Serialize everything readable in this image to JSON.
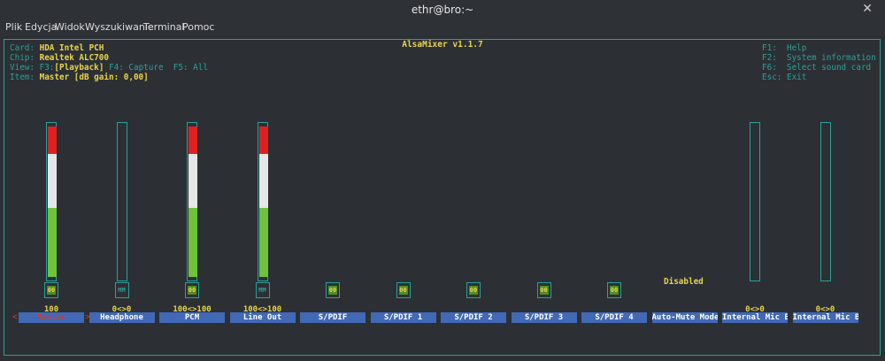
{
  "window": {
    "title": "ethr@bro:~"
  },
  "menu": [
    "Plik",
    "Edycja",
    "Widok",
    "Wyszukiwanie",
    "Terminal",
    "Pomoc"
  ],
  "mixer": {
    "title": "AlsaMixer v1.1.7",
    "card_label": "Card:",
    "card_value": "HDA Intel PCH",
    "chip_label": "Chip:",
    "chip_value": "Realtek ALC700",
    "view_label": "View:",
    "view_f3": "F3:",
    "view_playback": "[Playback]",
    "view_rest": "F4: Capture  F5: All",
    "item_label": "Item:",
    "item_value": "Master [dB gain: 0,00]",
    "help": [
      "F1:  Help",
      "F2:  System information",
      "F6:  Select sound card",
      "Esc: Exit"
    ],
    "disabled_text": "Disabled"
  },
  "controls": [
    {
      "name": "Master",
      "selected": true,
      "value_text": "100",
      "level": 1.0,
      "has_bar": true,
      "box": "00"
    },
    {
      "name": "Headphone",
      "value_text": "0<>0",
      "level": 0,
      "has_bar": true,
      "box": "MM"
    },
    {
      "name": "PCM",
      "value_text": "100<>100",
      "level": 1.0,
      "has_bar": true,
      "box": "00"
    },
    {
      "name": "Line Out",
      "value_text": "100<>100",
      "level": 1.0,
      "has_bar": true,
      "box": "MM"
    },
    {
      "name": "S/PDIF",
      "value_text": "",
      "has_bar": false,
      "box": "00"
    },
    {
      "name": "S/PDIF 1",
      "value_text": "",
      "has_bar": false,
      "box": "00"
    },
    {
      "name": "S/PDIF 2",
      "value_text": "",
      "has_bar": false,
      "box": "00"
    },
    {
      "name": "S/PDIF 3",
      "value_text": "",
      "has_bar": false,
      "box": "00"
    },
    {
      "name": "S/PDIF 4",
      "value_text": "",
      "has_bar": false,
      "box": "00"
    },
    {
      "name": "Auto-Mute Mode",
      "value_text": "",
      "has_bar": false,
      "box": ""
    },
    {
      "name": "Internal Mic B",
      "value_text": "0<>0",
      "level": 0,
      "has_bar": true,
      "box": ""
    },
    {
      "name": "Internal Mic B",
      "value_text": "0<>0",
      "level": 0,
      "has_bar": true,
      "box": ""
    }
  ],
  "colors": {
    "accent": "#2aa198",
    "highlight": "#e8d44d",
    "label_bg": "#4169b5",
    "selected_text": "#d23a2f",
    "bar_green": "#6fc23a",
    "bar_white": "#e6e6e6",
    "bar_red": "#e02020"
  }
}
